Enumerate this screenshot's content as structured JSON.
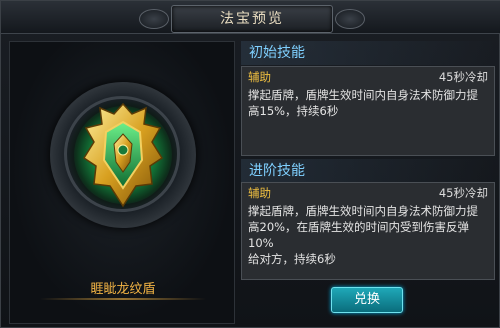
{
  "window": {
    "title": "法宝预览"
  },
  "item": {
    "name": "睚眦龙纹盾",
    "icon": "dragon-shield-icon"
  },
  "skills": [
    {
      "header": "初始技能",
      "tag": "辅助",
      "cooldown": "45秒冷却",
      "desc_lines": [
        "撑起盾牌，盾牌生效时间内自身法术防御力提",
        "高15%，持续6秒"
      ]
    },
    {
      "header": "进阶技能",
      "tag": "辅助",
      "cooldown": "45秒冷却",
      "desc_lines": [
        "撑起盾牌，盾牌生效时间内自身法术防御力提",
        "高20%，在盾牌生效的时间内受到伤害反弹10%",
        "给对方，持续6秒"
      ]
    }
  ],
  "actions": {
    "exchange_label": "兑换"
  },
  "colors": {
    "accent_gold": "#f0b244",
    "header_blue": "#7fd0ff",
    "button_teal": "#1fa8b8"
  }
}
